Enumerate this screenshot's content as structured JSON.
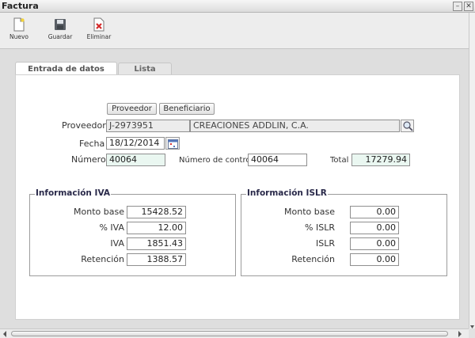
{
  "window": {
    "title": "Factura",
    "minimize_glyph": "–",
    "close_glyph": "✕"
  },
  "toolbar": {
    "new_label": "Nuevo",
    "save_label": "Guardar",
    "delete_label": "Eliminar"
  },
  "tabs": {
    "entry_label": "Entrada de datos",
    "list_label": "Lista"
  },
  "buttons": {
    "proveedor": "Proveedor",
    "beneficiario": "Beneficiario"
  },
  "form": {
    "proveedor_label": "Proveedor",
    "proveedor_id": "J-2973951",
    "proveedor_name": "CREACIONES ADDLIN, C.A.",
    "fecha_label": "Fecha",
    "fecha_value": "18/12/2014",
    "numero_label": "Número",
    "numero_value": "40064",
    "control_label": "Número de control",
    "control_value": "40064",
    "total_label": "Total",
    "total_value": "17279.94"
  },
  "iva": {
    "legend": "Información IVA",
    "rows": [
      {
        "label": "Monto base",
        "value": "15428.52"
      },
      {
        "label": "% IVA",
        "value": "12.00"
      },
      {
        "label": "IVA",
        "value": "1851.43"
      },
      {
        "label": "Retención",
        "value": "1388.57"
      }
    ]
  },
  "islr": {
    "legend": "Información ISLR",
    "rows": [
      {
        "label": "Monto base",
        "value": "0.00"
      },
      {
        "label": "% ISLR",
        "value": "0.00"
      },
      {
        "label": "ISLR",
        "value": "0.00"
      },
      {
        "label": "Retención",
        "value": "0.00"
      }
    ]
  },
  "icons": {
    "new": "new-document-icon",
    "save": "floppy-disk-icon",
    "delete": "delete-document-icon",
    "search": "magnifier-icon",
    "calendar": "calendar-icon"
  },
  "colors": {
    "highlight_field": "#eaf7f1",
    "readonly_field": "#ececec",
    "delete_red": "#d42a2a"
  }
}
